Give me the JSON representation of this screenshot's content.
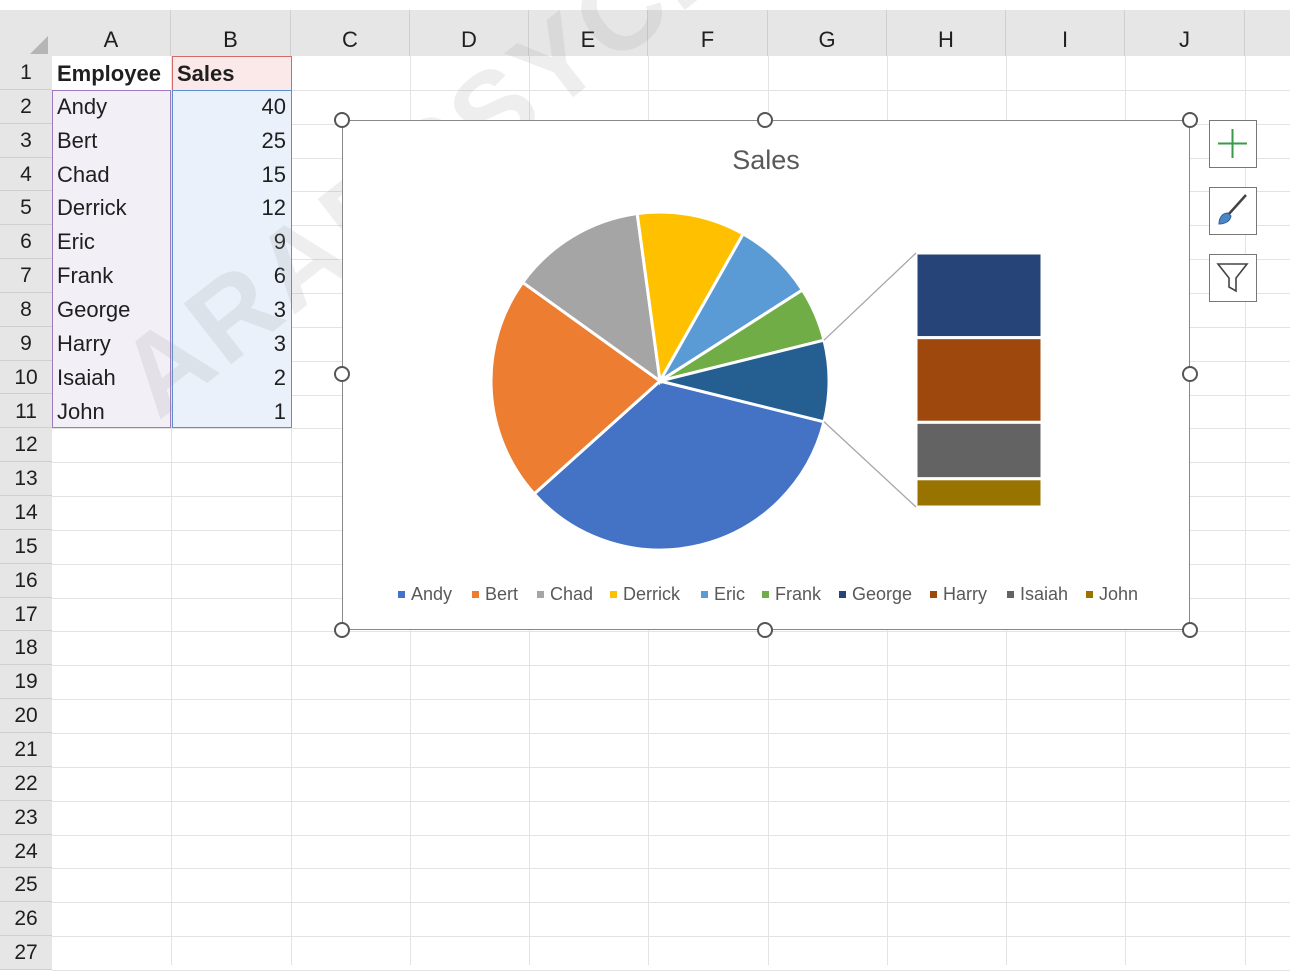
{
  "columns": [
    "A",
    "B",
    "C",
    "D",
    "E",
    "F",
    "G",
    "H",
    "I",
    "J"
  ],
  "rows": [
    "1",
    "2",
    "3",
    "4",
    "5",
    "6",
    "7",
    "8",
    "9",
    "10",
    "11",
    "12",
    "13",
    "14",
    "15",
    "16",
    "17",
    "18",
    "19",
    "20",
    "21",
    "22",
    "23",
    "24",
    "25",
    "26",
    "27"
  ],
  "table": {
    "headers": [
      "Employee",
      "Sales"
    ],
    "employees": [
      "Andy",
      "Bert",
      "Chad",
      "Derrick",
      "Eric",
      "Frank",
      "George",
      "Harry",
      "Isaiah",
      "John"
    ],
    "sales": [
      "40",
      "25",
      "15",
      "12",
      "9",
      "6",
      "3",
      "3",
      "2",
      "1"
    ]
  },
  "chart_data": {
    "type": "pie",
    "subtype": "bar-of-pie",
    "title": "Sales",
    "categories": [
      "Andy",
      "Bert",
      "Chad",
      "Derrick",
      "Eric",
      "Frank",
      "George",
      "Harry",
      "Isaiah",
      "John"
    ],
    "values": [
      40,
      25,
      15,
      12,
      9,
      6,
      3,
      3,
      2,
      1
    ],
    "secondary_plot_categories": [
      "George",
      "Harry",
      "Isaiah",
      "John"
    ],
    "colors": [
      "#4472c4",
      "#ed7d31",
      "#a5a5a5",
      "#ffc000",
      "#5b9bd5",
      "#70ad47",
      "#264478",
      "#9e480e",
      "#636363",
      "#997300"
    ],
    "legend": "bottom"
  },
  "chart_tools": {
    "add_element_icon": "plus-icon",
    "styles_icon": "paintbrush-icon",
    "filter_icon": "funnel-icon"
  },
  "watermark": "ARABPSYCHO..."
}
